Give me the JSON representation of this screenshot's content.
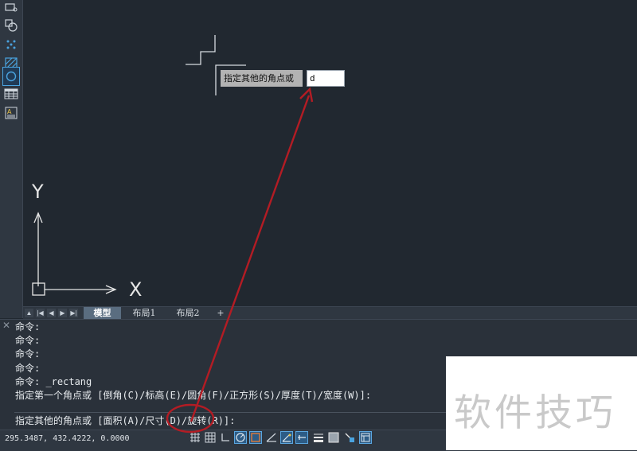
{
  "toolbar": {
    "tools": [
      "rectangle-tool-icon",
      "shape-tool-icon",
      "point-tool-icon",
      "hatch-tool-icon",
      "circle-tool-icon",
      "table-tool-icon",
      "text-tool-icon"
    ]
  },
  "canvas": {
    "ucs_y_label": "Y",
    "ucs_x_label": "X",
    "dynamic_input": {
      "prompt": "指定其他的角点或",
      "value": "d"
    }
  },
  "tabs": {
    "nav": [
      "▲",
      "|◀",
      "◀",
      "▶",
      "▶|"
    ],
    "items": [
      {
        "label": "模型",
        "active": true
      },
      {
        "label": "布局1",
        "active": false
      },
      {
        "label": "布局2",
        "active": false
      },
      {
        "label": "+",
        "active": false
      }
    ]
  },
  "command": {
    "close_glyph": "✕",
    "history": [
      "命令:",
      "命令:",
      "命令:",
      "命令:",
      "命令: _rectang",
      "指定第一个角点或 [倒角(C)/标高(E)/圆角(F)/正方形(S)/厚度(T)/宽度(W)]:"
    ],
    "current": "指定其他的角点或 [面积(A)/尺寸(D)/旋转(R)]:"
  },
  "status": {
    "coordinates": "295.3487, 432.4222, 0.0000",
    "icons": [
      "snap-grid-icon",
      "grid-display-icon",
      "ortho-icon",
      "polar-icon",
      "object-snap-icon",
      "snap-tracking-icon",
      "dynamic-ucs-icon",
      "dynamic-input-icon",
      "lineweight-icon",
      "transparency-icon",
      "selection-cycling-icon",
      "quick-properties-icon"
    ]
  },
  "annotation": {
    "color": "#b31c24"
  },
  "watermark": {
    "text": "软件技巧"
  }
}
